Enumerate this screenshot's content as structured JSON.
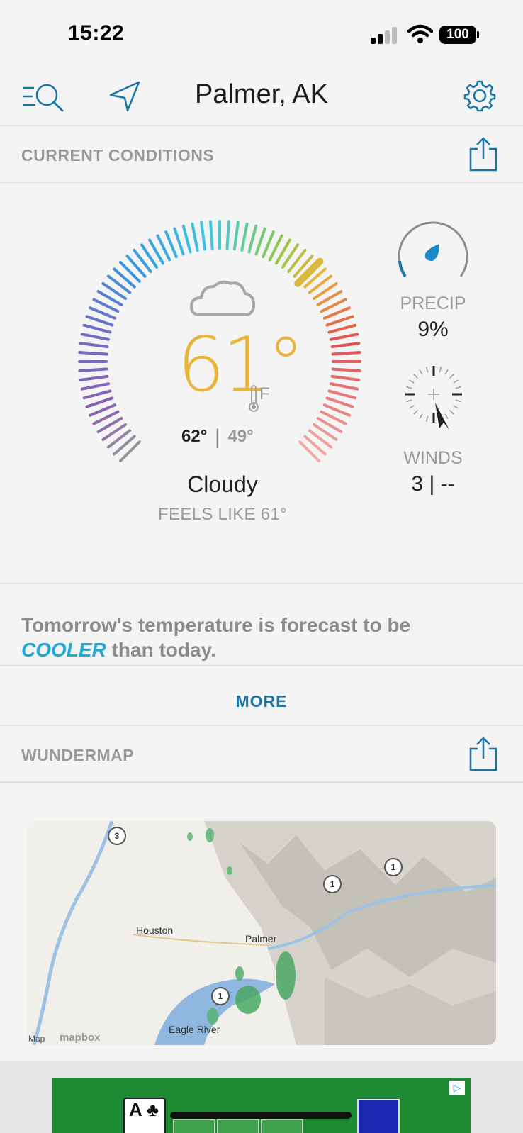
{
  "status_bar": {
    "time": "15:22",
    "battery": "100"
  },
  "header": {
    "title": "Palmer, AK"
  },
  "current_conditions": {
    "section_label": "CURRENT CONDITIONS",
    "temperature": "61°",
    "unit": "F",
    "high": "62°",
    "separator": "|",
    "low": "49°",
    "condition": "Cloudy",
    "feels_like": "FEELS LIKE 61°",
    "precip_label": "PRECIP",
    "precip_value": "9%",
    "winds_label": "WINDS",
    "winds_value": "3 | --"
  },
  "forecast": {
    "text_before": "Tomorrow's temperature is forecast to be",
    "highlight": "COOLER",
    "text_after": "than today.",
    "more_label": "MORE"
  },
  "wundermap": {
    "section_label": "WUNDERMAP",
    "places": {
      "houston": "Houston",
      "palmer": "Palmer",
      "eagle_river": "Eagle River"
    },
    "routes": {
      "r3": "3",
      "r1a": "1",
      "r1b": "1",
      "r1c": "1"
    },
    "attribution_map": "Map",
    "attribution_mapbox": "mapbox"
  },
  "ad": {
    "card": "A ♣"
  },
  "colors": {
    "accent": "#1a76a8",
    "temperature": "#e8b53a",
    "cooler": "#1fa9d9",
    "muted": "#9a9a9a"
  },
  "icons": [
    "search-menu-icon",
    "location-arrow-icon",
    "gear-icon",
    "share-icon",
    "cloud-icon",
    "thermometer-icon",
    "raindrop-icon",
    "wind-compass-icon"
  ]
}
